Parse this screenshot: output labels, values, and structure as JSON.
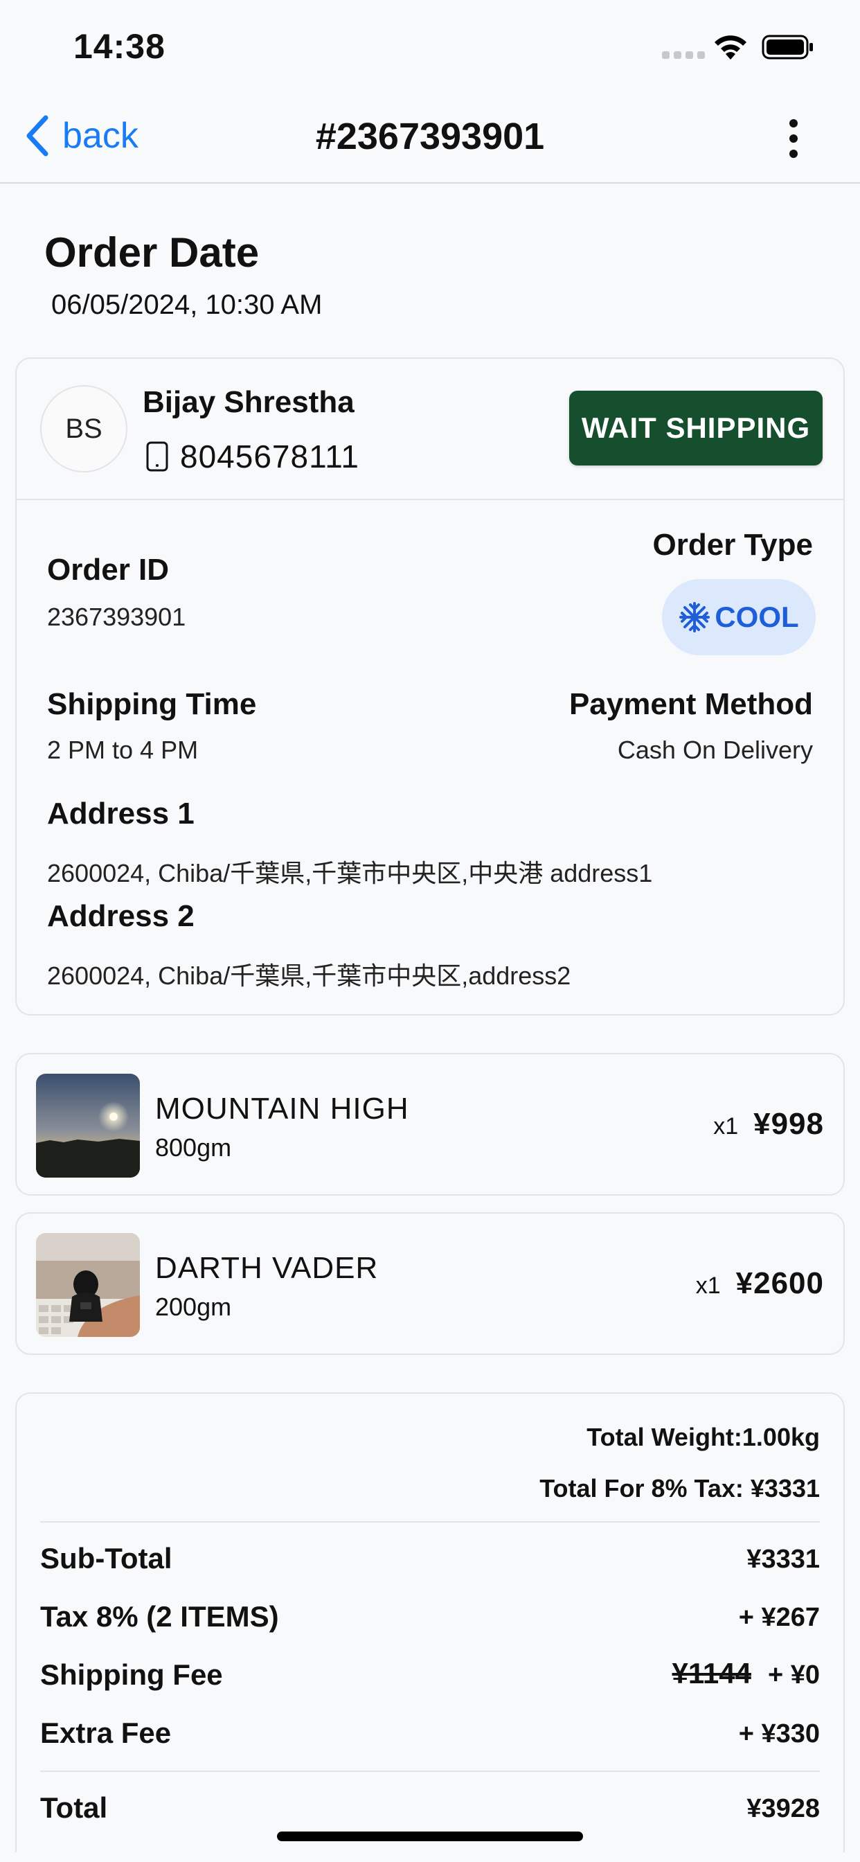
{
  "status_bar": {
    "time": "14:38"
  },
  "nav": {
    "back_label": "back",
    "title": "#2367393901"
  },
  "order_date": {
    "title": "Order Date",
    "value": "06/05/2024, 10:30 AM"
  },
  "customer": {
    "initials": "BS",
    "name": "Bijay Shrestha",
    "phone": "8045678111",
    "status": "WAIT SHIPPING",
    "status_color": "#154f2e"
  },
  "details": {
    "order_id_label": "Order ID",
    "order_id_value": "2367393901",
    "order_type_label": "Order Type",
    "order_type_value": "COOL",
    "order_type_icon": "snowflake-icon",
    "shipping_time_label": "Shipping Time",
    "shipping_time_value": "2 PM to 4 PM",
    "payment_method_label": "Payment Method",
    "payment_method_value": "Cash On Delivery",
    "address1_label": "Address 1",
    "address1_value": "2600024, Chiba/千葉県,千葉市中央区,中央港 address1",
    "address2_label": "Address 2",
    "address2_value": "2600024, Chiba/千葉県,千葉市中央区,address2"
  },
  "products": [
    {
      "name": "MOUNTAIN HIGH",
      "weight": "800gm",
      "qty": "x1",
      "price": "¥998"
    },
    {
      "name": "DARTH VADER",
      "weight": "200gm",
      "qty": "x1",
      "price": "¥2600"
    }
  ],
  "summary": {
    "total_weight": "Total Weight:1.00kg",
    "total_tax": "Total For 8% Tax: ¥3331",
    "subtotal_label": "Sub-Total",
    "subtotal_value": "¥3331",
    "tax_label": "Tax 8% (2 ITEMS)",
    "tax_value": "+ ¥267",
    "shipping_label": "Shipping Fee",
    "shipping_original": "¥1144",
    "shipping_value": "+ ¥0",
    "extra_label": "Extra Fee",
    "extra_value": "+ ¥330",
    "total_label": "Total",
    "total_value": "¥3928"
  },
  "colors": {
    "accent": "#1a7cf5",
    "cool_badge_bg": "#dce8fb",
    "cool_badge_text": "#1f5ed9"
  }
}
